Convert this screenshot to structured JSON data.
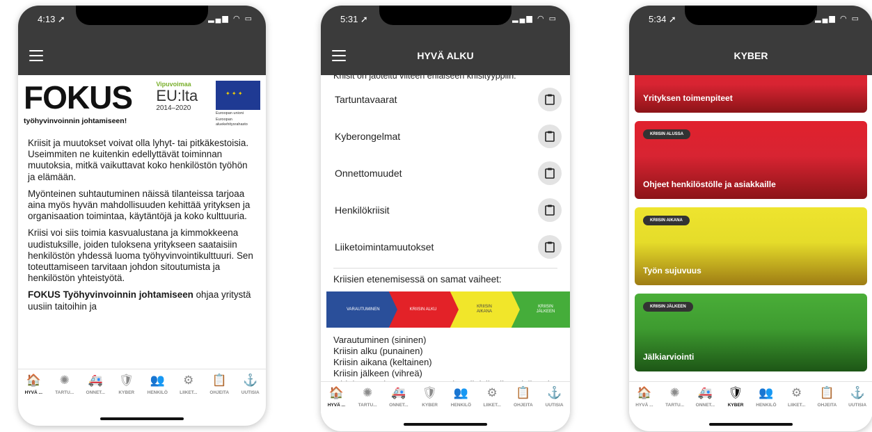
{
  "nav_items": [
    {
      "icon": "home-icon",
      "glyph": "🏠",
      "label": "HYVÄ ..."
    },
    {
      "icon": "virus-icon",
      "glyph": "✺",
      "label": "TARTU..."
    },
    {
      "icon": "ambulance-icon",
      "glyph": "🚑",
      "label": "ONNET..."
    },
    {
      "icon": "shield-lock-icon",
      "glyph": "🛡",
      "label": "KYBER"
    },
    {
      "icon": "people-icon",
      "glyph": "👥",
      "label": "HENKILÖ"
    },
    {
      "icon": "gears-icon",
      "glyph": "⚙",
      "label": "LIIKET..."
    },
    {
      "icon": "clipboard-icon",
      "glyph": "📋",
      "label": "OHJEITA"
    },
    {
      "icon": "anchor-icon",
      "glyph": "⚓",
      "label": "UUTISIA"
    }
  ],
  "phone1": {
    "time": "4:13 ➚",
    "status": "▂▄▆ ◠ ▭",
    "logo": {
      "fokus": "FOKUS",
      "tagline": "työhyvinvoinnin johtamiseen!",
      "vipu": "Vipuvoimaa",
      "eu": "EU:lta",
      "years": "2014–2020",
      "eu_union": "Euroopan unioni",
      "eu_fund": "Euroopan aluekehitysrahasto"
    },
    "p1": "Kriisit ja muutokset voivat olla lyhyt- tai pitkäkestoisia. Useimmiten ne kuitenkin edellyttävät toiminnan muutoksia, mitkä vaikuttavat koko henkilöstön työhön ja elämään.",
    "p2": "Myönteinen suhtautuminen näissä tilanteissa tarjoaa aina myös hyvän mahdollisuuden kehittää yrityksen ja organisaation toimintaa, käytäntöjä ja koko kulttuuria.",
    "p3": "Kriisi voi siis toimia kasvualustana ja kimmokkeena uudistuksille, joiden tuloksena yritykseen saataisiin henkilöstön yhdessä luoma työhyvinvointikulttuuri. Sen toteuttamiseen tarvitaan johdon sitoutumista ja henkilöstön yhteistyötä.",
    "p4_bold": "FOKUS Työhyvinvoinnin johtamiseen",
    "p4_rest": " ohjaa yritystä uusiin taitoihin ja"
  },
  "phone2": {
    "time": "5:31 ➚",
    "status": "▂▄▆ ◠ ▭",
    "title": "HYVÄ ALKU",
    "intro": "Kriisit on jaoteltu viiteen erilaiseen kriisityyppiin:",
    "crises": [
      "Tartuntavaarat",
      "Kyberongelmat",
      "Onnettomuudet",
      "Henkilökriisit",
      "Liiketoimintamuutokset"
    ],
    "phases_title": "Kriisien etenemisessä on samat vaiheet:",
    "phases": [
      {
        "label": "VARAUTUMINEN",
        "color": "#2a4f9a",
        "text_color": "#ffffff"
      },
      {
        "label": "KRIISIN ALKU",
        "color": "#e32228",
        "text_color": "#ffffff"
      },
      {
        "label": "KRIISIN AIKANA",
        "color": "#f1e62a",
        "text_color": "#444444"
      },
      {
        "label": "KRIISIN JÄLKEEN",
        "color": "#45ad3a",
        "text_color": "#ffffff"
      }
    ],
    "phase_list": [
      "Varautuminen (sininen)",
      "Kriisin alku (punainen)",
      "Kriisin aikana (keltainen)",
      "Kriisin jälkeen (vihreä)"
    ],
    "behind_text": "Ohjeissa on käytännön neuvoja erilaisiin tilanteisiin eri vaiheissa."
  },
  "phone3": {
    "time": "5:34 ➚",
    "status": "▂▄▆ ◠ ▭",
    "title": "KYBER",
    "cards": [
      {
        "tag": "",
        "title": "Yrityksen toimenpiteet",
        "style": "red-card"
      },
      {
        "tag": "KRIISIN ALUSSA",
        "title": "Ohjeet henkilöstölle ja asiakkaille",
        "style": "red-card"
      },
      {
        "tag": "KRIISIN AIKANA",
        "title": "Työn sujuvuus",
        "style": "yellow-card"
      },
      {
        "tag": "KRIISIN JÄLKEEN",
        "title": "Jälkiarviointi",
        "style": "green-card"
      }
    ]
  },
  "active_nav": {
    "phone1": 0,
    "phone2": 0,
    "phone3": 3
  }
}
